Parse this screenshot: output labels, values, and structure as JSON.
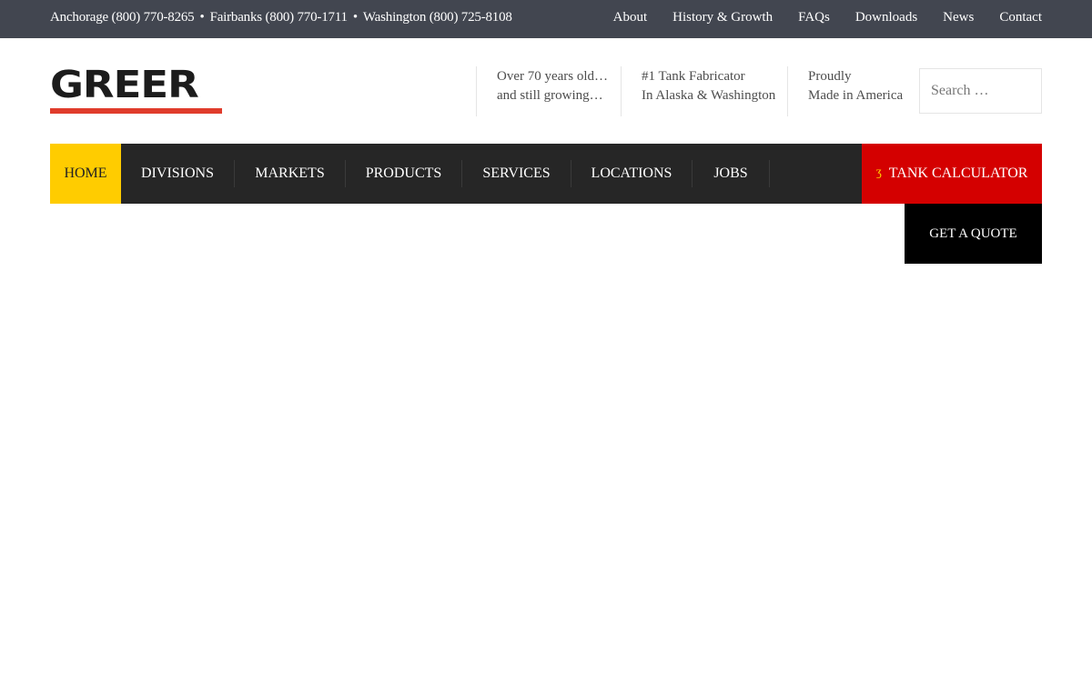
{
  "topbar": {
    "phones": [
      {
        "label": "Anchorage (800) 770-8265"
      },
      {
        "label": "Fairbanks (800) 770-1711"
      },
      {
        "label": "Washington (800) 725-8108"
      }
    ],
    "separator": "•",
    "links": [
      "About",
      "History & Growth",
      "FAQs",
      "Downloads",
      "News",
      "Contact"
    ]
  },
  "header": {
    "logo_text": "GREER",
    "taglines": [
      {
        "line1": "Over 70 years old…",
        "line2": "and still growing…"
      },
      {
        "line1": "#1 Tank Fabricator",
        "line2": "In Alaska & Washington"
      },
      {
        "line1": "Proudly",
        "line2": "Made in America"
      }
    ],
    "search": {
      "placeholder": "Search …",
      "value": ""
    }
  },
  "nav": {
    "items": [
      "HOME",
      "DIVISIONS",
      "MARKETS",
      "PRODUCTS",
      "SERVICES",
      "LOCATIONS",
      "JOBS"
    ],
    "active": "HOME",
    "calculator_label": "TANK CALCULATOR",
    "calculator_icon": "calculator-icon",
    "quote_label": "GET A QUOTE"
  },
  "colors": {
    "topbar_bg": "#424650",
    "nav_bg": "#262626",
    "active_bg": "#ffcc00",
    "calculator_bg": "#d40000",
    "quote_bg": "#000000",
    "logo_underline": "#e03c2c"
  }
}
